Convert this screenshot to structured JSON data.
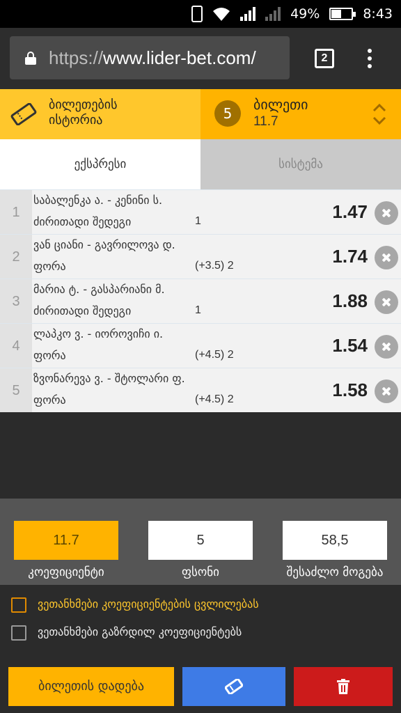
{
  "status_bar": {
    "battery": "49%",
    "time": "8:43"
  },
  "browser": {
    "url_scheme": "https://",
    "url_host": "www.lider-bet.com/",
    "tab_count": "2"
  },
  "ticket_header": {
    "history_label_line1": "ბილეთების",
    "history_label_line2": "ისტორია",
    "selection_count": "5",
    "ticket_title": "ბილეთი",
    "ticket_odd": "11.7"
  },
  "mode_tabs": {
    "express": "ექსპრესი",
    "system": "სისტემა"
  },
  "bets": [
    {
      "num": "1",
      "event": "საბალენკა ა. - კენინი ს.",
      "market": "ძირითადი შედეგი",
      "outcome": "1",
      "coef": "1.47"
    },
    {
      "num": "2",
      "event": "ვან ციანი - გავრილოვა დ.",
      "market": "ფორა",
      "outcome": "(+3.5) 2",
      "coef": "1.74"
    },
    {
      "num": "3",
      "event": "მარია ტ. - გასპარიანი მ.",
      "market": "ძირითადი შედეგი",
      "outcome": "1",
      "coef": "1.88"
    },
    {
      "num": "4",
      "event": "ლაპკო ვ. - იოროვიჩი ი.",
      "market": "ფორა",
      "outcome": "(+4.5) 2",
      "coef": "1.54"
    },
    {
      "num": "5",
      "event": "ზვონარევა ვ. - შტოლარი ფ.",
      "market": "ფორა",
      "outcome": "(+4.5) 2",
      "coef": "1.58"
    }
  ],
  "summary": {
    "coef_value": "11.7",
    "coef_label": "კოეფიციენტი",
    "stake_value": "5",
    "stake_label": "ფსონი",
    "win_value": "58,5",
    "win_label": "შესაძლო მოგება"
  },
  "options": {
    "accept_changes": "ვეთანხმები კოეფიციენტების ცვლილებას",
    "accept_increased": "ვეთანხმები გაზრდილ კოეფიციენტებს"
  },
  "actions": {
    "place_bet": "ბილეთის დადება"
  },
  "colors": {
    "accent_yellow": "#ffb300",
    "light_yellow": "#ffc72c",
    "blue": "#3e7be6",
    "red": "#cc1b1b"
  }
}
